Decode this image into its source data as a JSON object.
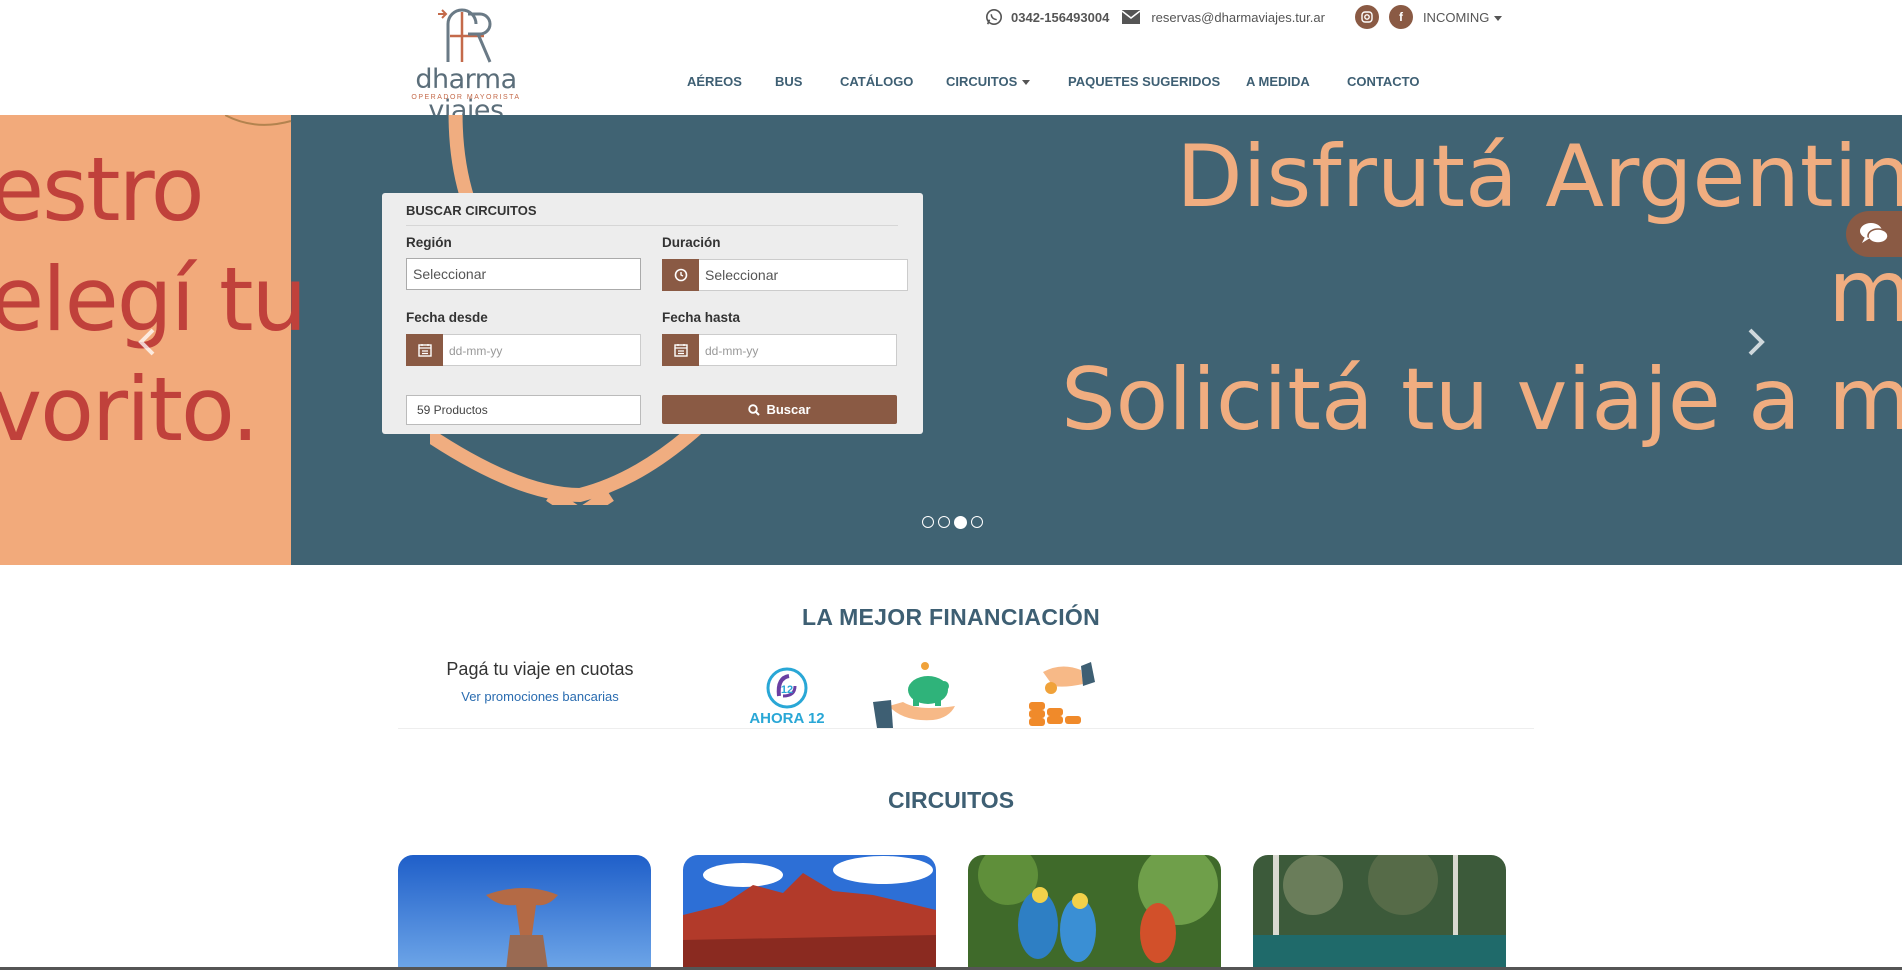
{
  "brand": {
    "name": "dharma viajes",
    "tagline": "OPERADOR MAYORISTA"
  },
  "contact": {
    "phone": "0342-156493004",
    "email": "reservas@dharmaviajes.tur.ar",
    "instagram_icon": "instagram-icon",
    "facebook_icon": "facebook-icon",
    "language_label": "INCOMING"
  },
  "nav": {
    "items": [
      {
        "label": "AÉREOS"
      },
      {
        "label": "BUS"
      },
      {
        "label": "CATÁLOGO"
      },
      {
        "label": "CIRCUITOS"
      },
      {
        "label": "PAQUETES SUGERIDOS"
      },
      {
        "label": "A MEDIDA"
      },
      {
        "label": "CONTACTO"
      }
    ]
  },
  "hero": {
    "left_lines": [
      "estro",
      "elegí tu",
      "vorito."
    ],
    "right_lines": [
      "Disfrutá Argentin",
      "m",
      "Solicitá tu viaje a m"
    ],
    "slides_total": 4,
    "active_slide": 3
  },
  "search": {
    "title": "BUSCAR CIRCUITOS",
    "region_label": "Región",
    "region_value": "Seleccionar",
    "duracion_label": "Duración",
    "duracion_value": "Seleccionar",
    "fecha_desde_label": "Fecha desde",
    "fecha_desde_placeholder": "dd-mm-yy",
    "fecha_hasta_label": "Fecha hasta",
    "fecha_hasta_placeholder": "dd-mm-yy",
    "count": "59 Productos",
    "button": "Buscar"
  },
  "financing": {
    "title": "LA MEJOR FINANCIACIÓN",
    "subtitle": "Pagá tu viaje en cuotas",
    "link": "Ver promociones bancarias",
    "ahora_label": "AHORA 12"
  },
  "circuits": {
    "title": "CIRCUITOS"
  },
  "colors": {
    "brand_brown": "#8a5a44",
    "nav_blue": "#3e5f73",
    "hero_bg": "#406373",
    "hero_peach": "#f2aa7b"
  }
}
